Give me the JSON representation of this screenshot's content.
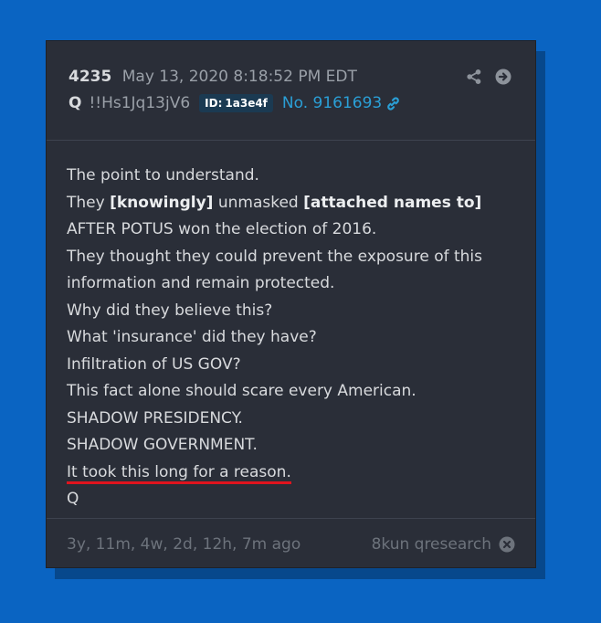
{
  "post": {
    "number": "4235",
    "timestamp": "May 13, 2020 8:18:52 PM EDT",
    "author": "Q",
    "tripcode": "!!Hs1Jq13jV6",
    "id_label": "ID:",
    "id_value": "1a3e4f",
    "post_ref": "No. 9161693"
  },
  "body": {
    "line1": "The point to understand.",
    "line2_a": "They ",
    "line2_b": "[knowingly]",
    "line2_c": " unmasked ",
    "line2_d": "[attached names to]",
    "line3": "AFTER POTUS won the election of 2016.",
    "line4": "They thought they could prevent the exposure of this",
    "line5": "information and remain protected.",
    "line6": "Why did they believe this?",
    "line7": "What 'insurance' did they have?",
    "line8": "Infiltration of US GOV?",
    "line9": "This fact alone should scare every American.",
    "line10": "SHADOW PRESIDENCY.",
    "line11": "SHADOW GOVERNMENT.",
    "line12": "It took this long for a reason.",
    "line13": "Q"
  },
  "footer": {
    "time_ago": "3y, 11m, 4w, 2d, 12h, 7m ago",
    "board": "8kun qresearch"
  },
  "colors": {
    "page_background": "#0a64c2",
    "card_background": "#2a2e38",
    "link": "#2a9fd6",
    "underline": "#e0141e"
  },
  "icons": [
    "share-icon",
    "arrow-right-circle-icon",
    "link-icon",
    "close-circle-icon"
  ]
}
